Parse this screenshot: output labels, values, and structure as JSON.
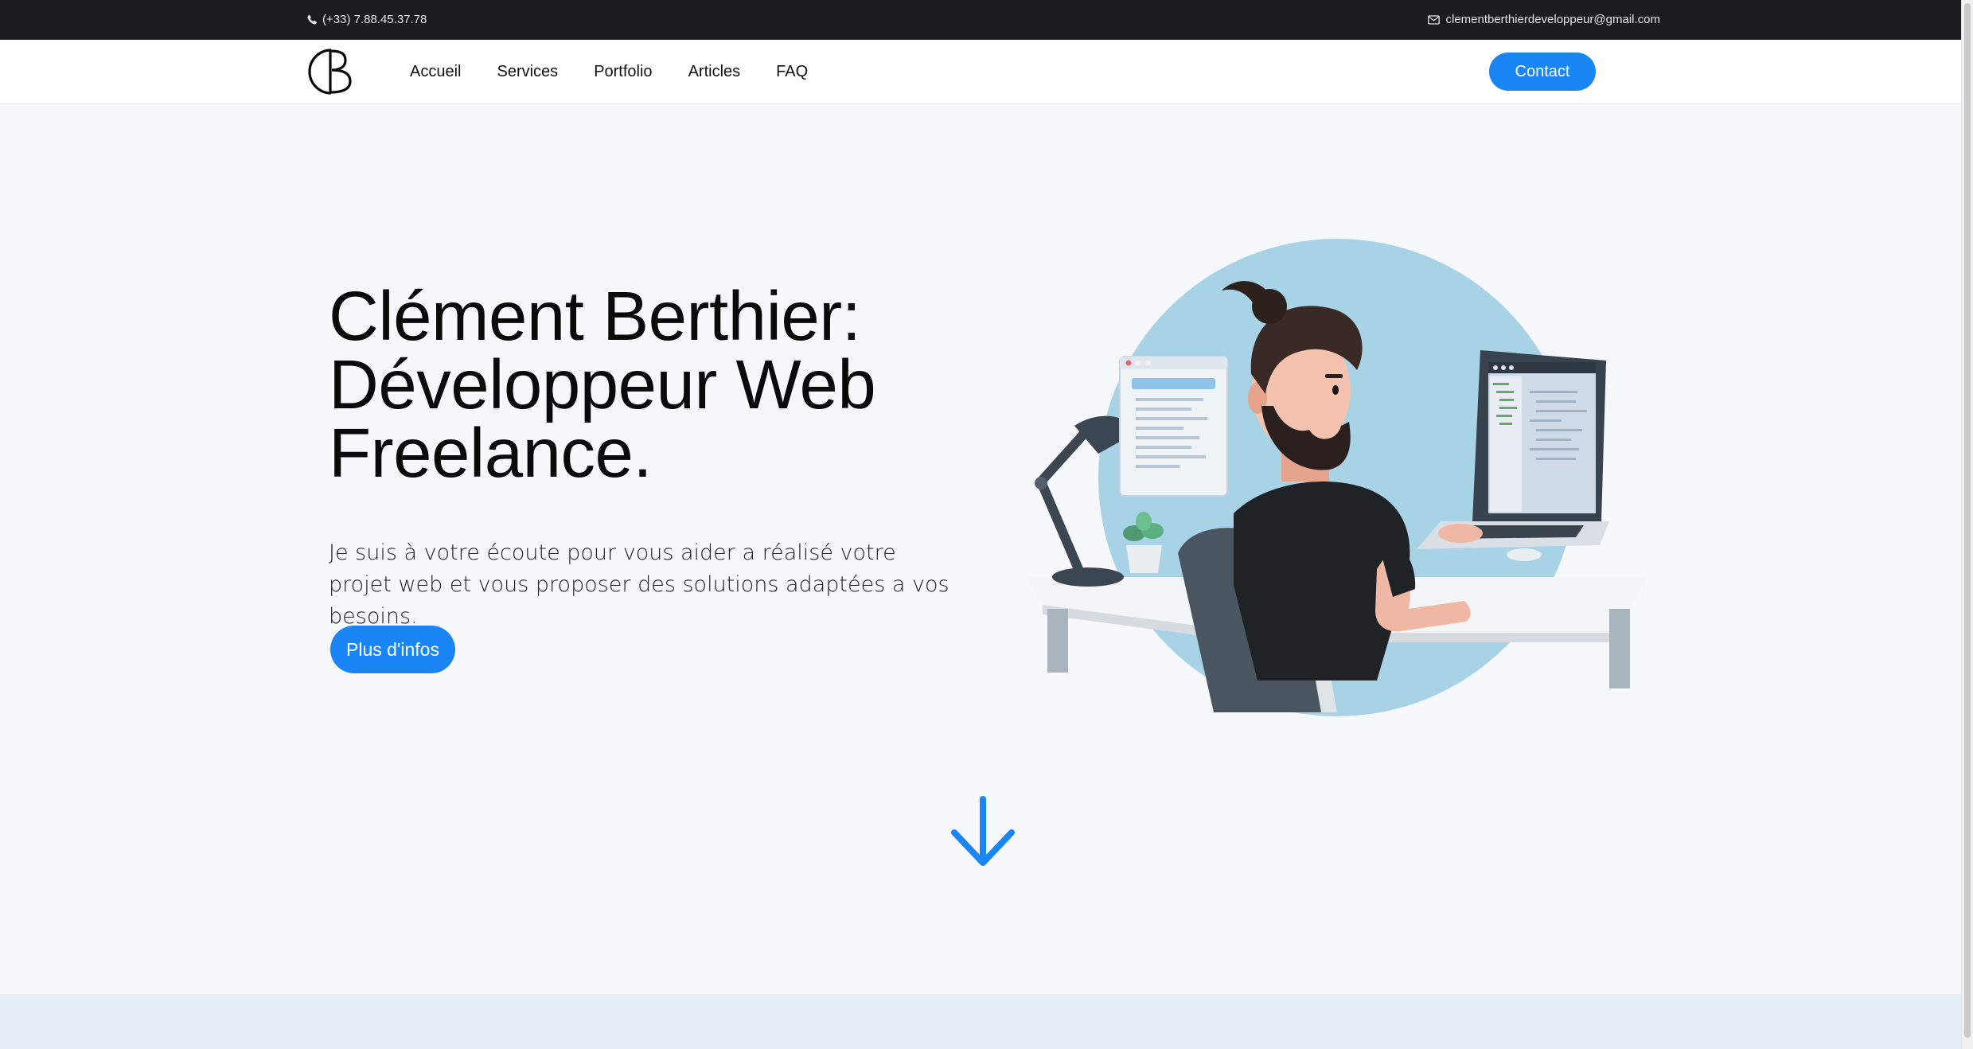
{
  "topbar": {
    "phone": "(+33) 7.88.45.37.78",
    "email": "clementberthierdeveloppeur@gmail.com"
  },
  "navbar": {
    "logo": "CB",
    "items": [
      "Accueil",
      "Services",
      "Portfolio",
      "Articles",
      "FAQ"
    ],
    "contact_label": "Contact"
  },
  "hero": {
    "title_lines": [
      "Clément Berthier:",
      "Développeur Web",
      "Freelance."
    ],
    "text": "Je suis à votre écoute pour vous aider a réalisé votre projet web et vous proposer des solutions adaptées a vos besoins.",
    "button_label": "Plus d'infos"
  },
  "icons": {
    "phone": "phone-icon",
    "email": "mail-icon",
    "scroll": "arrow-down-icon"
  },
  "colors": {
    "accent": "#1a86f5",
    "topbar_bg": "#1c1c1e",
    "page_bg": "#f7f8fc",
    "section_bg": "#e6eef8"
  }
}
